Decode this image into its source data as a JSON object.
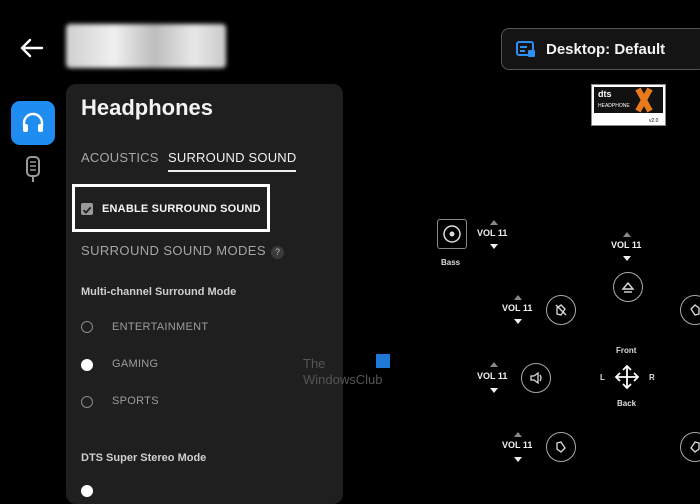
{
  "header": {
    "profile_label": "Desktop: Default"
  },
  "panel": {
    "title": "Headphones",
    "tabs": [
      {
        "label": "ACOUSTICS",
        "active": false
      },
      {
        "label": "SURROUND SOUND",
        "active": true
      }
    ],
    "enable_surround": {
      "label": "ENABLE SURROUND SOUND",
      "checked": true
    },
    "modes_heading": "SURROUND SOUND MODES",
    "help_glyph": "?",
    "multichannel": {
      "heading": "Multi-channel Surround Mode",
      "options": [
        {
          "label": "ENTERTAINMENT",
          "selected": false
        },
        {
          "label": "GAMING",
          "selected": true
        },
        {
          "label": "SPORTS",
          "selected": false
        }
      ]
    },
    "stereo": {
      "heading": "DTS Super Stereo Mode"
    }
  },
  "mixer": {
    "bass_label": "Bass",
    "volumes": [
      "VOL 11",
      "VOL 11",
      "VOL 11",
      "VOL 11",
      "VOL 11"
    ],
    "directions": {
      "front": "Front",
      "back": "Back",
      "left": "L",
      "right": "R"
    }
  },
  "watermark": {
    "line1": "The",
    "line2": "WindowsClub"
  },
  "colors": {
    "accent": "#1e8cf0",
    "panel": "#1f1f1f",
    "background": "#000000"
  }
}
